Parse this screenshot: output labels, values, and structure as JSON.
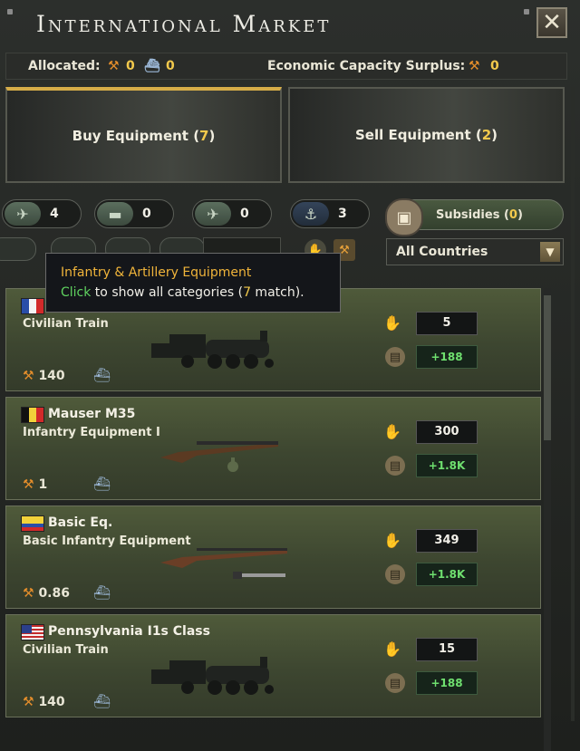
{
  "window": {
    "title": "International Market",
    "close_icon": "close-icon"
  },
  "info": {
    "allocated_label": "Allocated:",
    "allocated_civ": "0",
    "allocated_conv": "0",
    "surplus_label": "Economic Capacity Surplus:",
    "surplus_value": "0"
  },
  "actions": {
    "buy": {
      "label": "Buy Equipment",
      "count": "7"
    },
    "sell": {
      "label": "Sell Equipment",
      "count": "2"
    }
  },
  "categories": [
    {
      "icon": "infantry-icon",
      "count": "4"
    },
    {
      "icon": "tank-icon",
      "count": "0"
    },
    {
      "icon": "plane-icon",
      "count": "0"
    },
    {
      "icon": "anchor-icon",
      "count": "3"
    }
  ],
  "subsidies": {
    "label": "Subsidies",
    "count": "0"
  },
  "country_filter": {
    "selected": "All Countries"
  },
  "tooltip": {
    "title": "Infantry & Artillery Equipment",
    "click_word": "Click",
    "body_a": " to show all categories (",
    "match_count": "7",
    "body_b": " match)."
  },
  "listings": [
    {
      "flag": "france",
      "name": "",
      "type": "Civilian Train",
      "cost": "140",
      "amount": "5",
      "available": "+188",
      "picture": "train"
    },
    {
      "flag": "belgium",
      "name": "Mauser M35",
      "type": "Infantry Equipment I",
      "cost": "1",
      "amount": "300",
      "available": "+1.8K",
      "picture": "rifle-grenade"
    },
    {
      "flag": "ecuador",
      "name": "Basic Eq.",
      "type": "Basic Infantry Equipment",
      "cost": "0.86",
      "amount": "349",
      "available": "+1.8K",
      "picture": "rifle-bayonet"
    },
    {
      "flag": "usa",
      "name": "Pennsylvania I1s Class",
      "type": "Civilian Train",
      "cost": "140",
      "amount": "15",
      "available": "+188",
      "picture": "train"
    }
  ],
  "colors": {
    "accent_yellow": "#f2c94c",
    "positive_green": "#6fe06f",
    "gold_border": "#d6ad48"
  }
}
